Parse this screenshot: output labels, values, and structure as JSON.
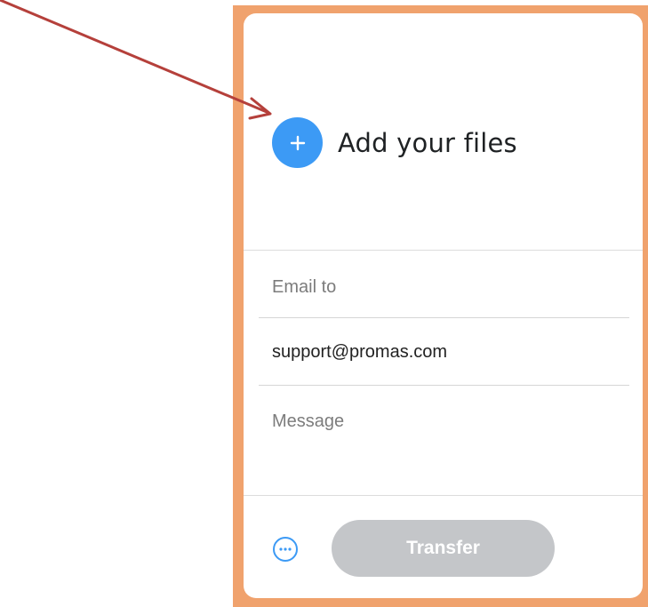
{
  "upload_card": {
    "add_files_label": "Add your files",
    "email_to_placeholder": "Email to",
    "email_to_value": "support@promas.com",
    "message_placeholder": "Message",
    "transfer_label": "Transfer"
  },
  "colors": {
    "accent_blue": "#3c9af5",
    "frame_orange": "#f0a26d",
    "arrow_red": "#b5403b",
    "transfer_disabled": "#c4c6c9"
  },
  "icons": {
    "add": "plus-icon",
    "more": "more-options-icon",
    "annotation": "pointer-arrow"
  }
}
